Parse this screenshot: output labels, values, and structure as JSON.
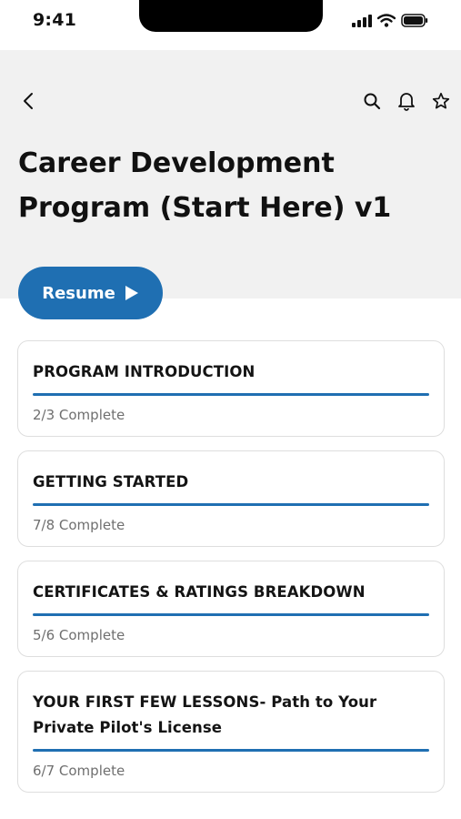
{
  "status_bar": {
    "time": "9:41"
  },
  "page": {
    "title": "Career Development Program (Start Here) v1"
  },
  "resume_button": {
    "label": "Resume"
  },
  "colors": {
    "accent": "#1f6fb2",
    "header_bg": "#f1f1f1",
    "track": "#dcdcdc"
  },
  "icons": [
    "back-icon",
    "search-icon",
    "bell-icon",
    "star-icon",
    "play-icon",
    "signal-icon",
    "wifi-icon",
    "battery-icon"
  ],
  "modules": [
    {
      "title": "PROGRAM INTRODUCTION",
      "status": "2/3 Complete",
      "progress": 1.0
    },
    {
      "title": "GETTING STARTED",
      "status": "7/8 Complete",
      "progress": 1.0
    },
    {
      "title": "CERTIFICATES & RATINGS BREAKDOWN",
      "status": "5/6 Complete",
      "progress": 1.0
    },
    {
      "title": "YOUR FIRST FEW LESSONS- Path to Your Private Pilot's License",
      "status": "6/7 Complete",
      "progress": 1.0
    }
  ]
}
